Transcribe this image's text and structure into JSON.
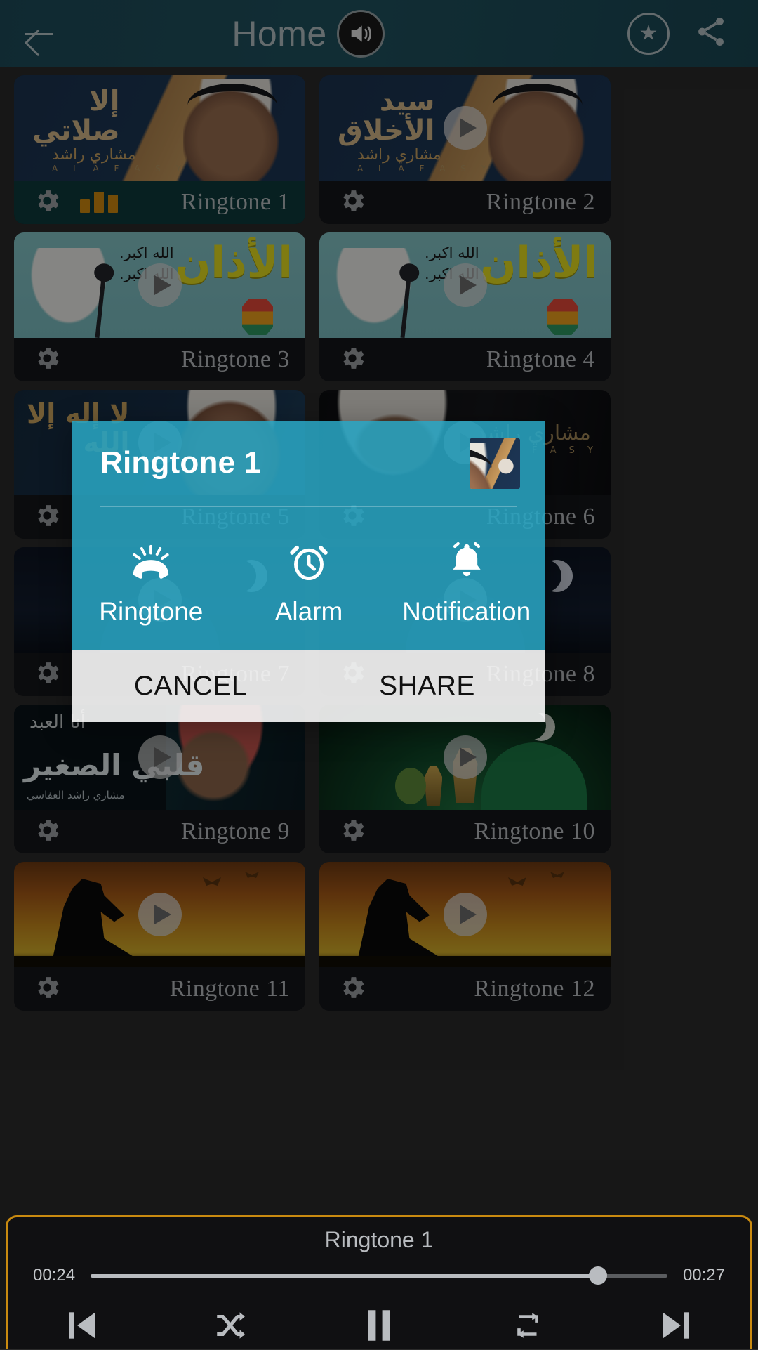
{
  "header": {
    "title": "Home",
    "back_icon": "arrow-left-icon",
    "speaker_icon": "speaker-icon",
    "star_icon": "star-icon",
    "share_icon": "share-icon"
  },
  "theme": {
    "appbar_bg": "#1e4c5a",
    "dialog_bg": "#29a4c2",
    "accent_orange": "#c98a10",
    "active_card_bg": "#0d3b3d",
    "card_bg": "#15161a"
  },
  "grid": {
    "items": [
      {
        "label": "Ringtone 1",
        "art": "alafasy",
        "active": true,
        "playing": true
      },
      {
        "label": "Ringtone 2",
        "art": "alafasy2",
        "active": false,
        "playing": false
      },
      {
        "label": "Ringtone 3",
        "art": "adhan",
        "active": false,
        "playing": false
      },
      {
        "label": "Ringtone 4",
        "art": "adhan",
        "active": false,
        "playing": false
      },
      {
        "label": "Ringtone 5",
        "art": "lailaha",
        "active": false,
        "playing": false
      },
      {
        "label": "Ringtone 6",
        "art": "dark-dua",
        "active": false,
        "playing": false
      },
      {
        "label": "Ringtone 7",
        "art": "night",
        "active": false,
        "playing": false
      },
      {
        "label": "Ringtone 8",
        "art": "night",
        "active": false,
        "playing": false
      },
      {
        "label": "Ringtone 9",
        "art": "qalby",
        "active": false,
        "playing": false
      },
      {
        "label": "Ringtone 10",
        "art": "mosque-green",
        "active": false,
        "playing": false
      },
      {
        "label": "Ringtone 11",
        "art": "sunset",
        "active": false,
        "playing": false
      },
      {
        "label": "Ringtone 12",
        "art": "sunset",
        "active": false,
        "playing": false
      }
    ],
    "artwork_text": {
      "alafasy_line1": "إلا",
      "alafasy_line2": "صلاتي",
      "alafasy2_line1": "سيد",
      "alafasy2_line2": "الأخلاق",
      "brand_ar": "مشاري راشد",
      "brand_en": "A L A F A S Y",
      "adhan_word": "الأذان",
      "adhan_takbir": "الله اكبر.\nالله اكبر.",
      "lailaha_line1": "لا إله إلا",
      "lailaha_line2": "الله",
      "qalby_line1": "أنا العبد",
      "qalby_line2": "قلبي الصغير",
      "qalby_line3": "مشاري راشد العفاسي"
    },
    "gear_icon": "gear-icon",
    "play_icon": "play-icon",
    "equalizer_icon": "equalizer-icon"
  },
  "dialog": {
    "title": "Ringtone 1",
    "thumbnail_icon": "ringtone-thumbnail",
    "options": [
      {
        "label": "Ringtone",
        "icon": "ringtone-phone-icon"
      },
      {
        "label": "Alarm",
        "icon": "alarm-clock-icon"
      },
      {
        "label": "Notification",
        "icon": "bell-icon"
      }
    ],
    "cancel_label": "CANCEL",
    "share_label": "SHARE"
  },
  "player": {
    "title": "Ringtone 1",
    "current_time": "00:24",
    "total_time": "00:27",
    "progress_percent": 88,
    "controls": [
      {
        "name": "previous-button",
        "icon": "skip-previous-icon"
      },
      {
        "name": "shuffle-button",
        "icon": "shuffle-icon"
      },
      {
        "name": "pause-button",
        "icon": "pause-icon"
      },
      {
        "name": "repeat-button",
        "icon": "repeat-icon"
      },
      {
        "name": "next-button",
        "icon": "skip-next-icon"
      }
    ]
  }
}
